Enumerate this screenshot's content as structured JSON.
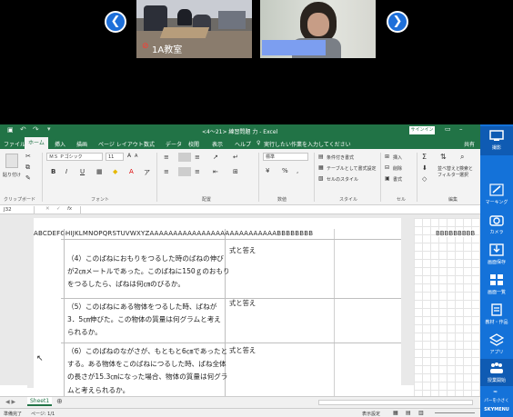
{
  "video": {
    "classroom_label": "1A教室"
  },
  "excel": {
    "title": "<4～21> 練習問題 力 - Excel",
    "signin": "サインイン",
    "share": "共有",
    "menu": [
      "ファイル",
      "ホーム",
      "挿入",
      "描画",
      "ページ レイアウト",
      "数式",
      "データ",
      "校閲",
      "表示",
      "ヘルプ",
      "実行したい作業を入力してください"
    ],
    "ribbon": {
      "paste": "貼り付け",
      "clipboard": "クリップボード",
      "font_name": "ＭＳ Ｐゴシック",
      "font_size": "11",
      "font": "フォント",
      "alignment": "配置",
      "number_format": "標準",
      "number": "数値",
      "cond_format": "条件付き書式",
      "table_format": "テーブルとして書式設定",
      "cell_style": "セルのスタイル",
      "styles": "スタイル",
      "insert": "挿入",
      "delete": "削除",
      "format": "書式",
      "cells": "セル",
      "sort": "並べ替えと",
      "filter": "フィルター",
      "find": "検索と",
      "select": "選択",
      "editing": "編集"
    },
    "name_box": "J32",
    "fx": "fx",
    "column_header_left": "ABCDEFGHIJKLMNOPQRSTUVWXYZAAAAAAAAAAAAAAAAAAAAAAAAAAABBBBBBBB",
    "column_header_right": "BBBBBBBBB",
    "questions": [
      {
        "lines": [
          "（4）このばねにおもりをつるした時のばねの伸び",
          "が2㎝メートルであった。このばねに150ｇのおもり",
          "をつるしたら、ばねは何㎝のびるか。"
        ],
        "answer": "式と答え"
      },
      {
        "lines": [
          "（5）このばねにある物体をつるした時、ばねが",
          "3．5㎝伸びた。この物体の質量は何グラムと考え",
          "られるか。"
        ],
        "answer": "式と答え"
      },
      {
        "lines": [
          "（6）このばねのながさが、もともと6㎝であったと",
          "する。ある物体をこのばねにつるした時、ばね全体",
          "の長さが15.3㎝になった場合、物体の質量は何グラ",
          "ムと考えられるか。"
        ],
        "answer": "式と答え"
      }
    ],
    "sheet_tab": "Sheet1",
    "status": "準備完了",
    "page_info": "ページ: 1/1",
    "display_settings": "表示設定"
  },
  "panel": {
    "items": [
      "撮影",
      "マーキング",
      "カメラ",
      "画面保存",
      "画面一覧",
      "教材・作品",
      "アプリ",
      "授業開始"
    ],
    "bottom": "パーを小さく",
    "brand": "SKYMENU"
  },
  "colors": {
    "excel_green": "#217346",
    "panel_blue": "#1472d9"
  }
}
